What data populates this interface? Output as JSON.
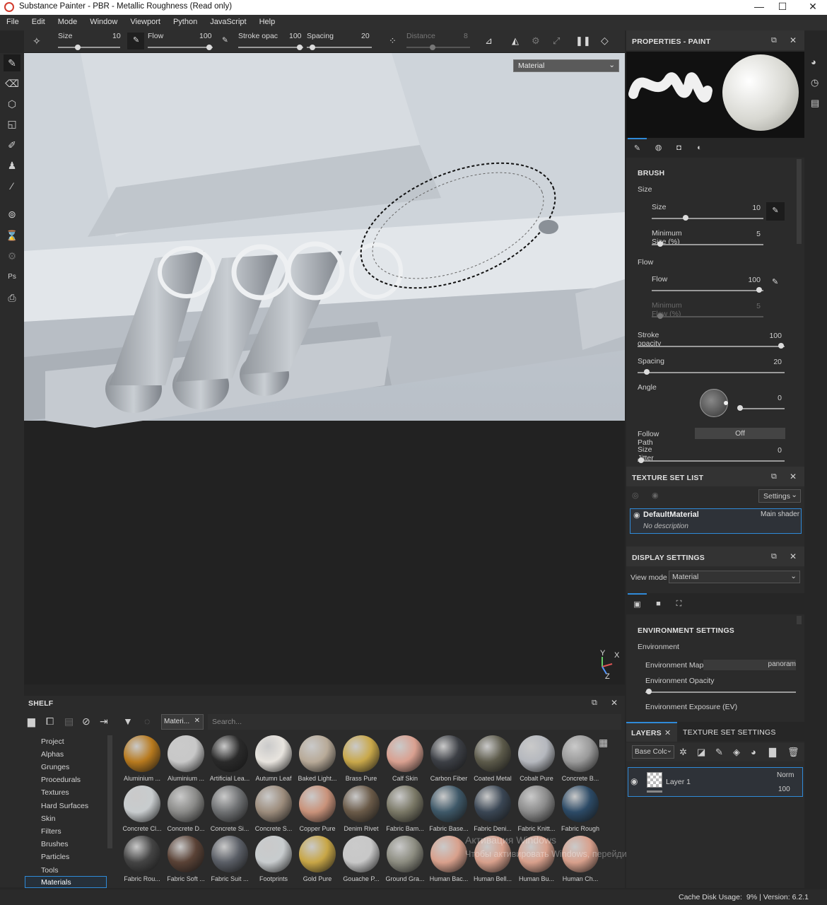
{
  "window": {
    "title": "Substance Painter - PBR - Metallic Roughness (Read only)"
  },
  "menu": [
    "File",
    "Edit",
    "Mode",
    "Window",
    "Viewport",
    "Python",
    "JavaScript",
    "Help"
  ],
  "toolbar": {
    "size_label": "Size",
    "size_value": "10",
    "flow_label": "Flow",
    "flow_value": "100",
    "stroke_label": "Stroke opac",
    "stroke_value": "100",
    "spacing_label": "Spacing",
    "spacing_value": "20",
    "distance_label": "Distance",
    "distance_value": "8"
  },
  "viewport": {
    "mode": "Material",
    "axis_y": "Y",
    "axis_x": "X",
    "axis_z": "Z"
  },
  "shelf": {
    "title": "SHELF",
    "filter_tag": "Materi...",
    "search_placeholder": "Search...",
    "categories": [
      "Project",
      "Alphas",
      "Grunges",
      "Procedurals",
      "Textures",
      "Hard Surfaces",
      "Skin",
      "Filters",
      "Brushes",
      "Particles",
      "Tools",
      "Materials"
    ],
    "materials": [
      {
        "label": "Aluminium ...",
        "color": "#b87a1e"
      },
      {
        "label": "Aluminium ...",
        "color": "#c8c8c8"
      },
      {
        "label": "Artificial Lea...",
        "color": "#2a2a2a"
      },
      {
        "label": "Autumn Leaf",
        "color": "#e8e4de"
      },
      {
        "label": "Baked Light...",
        "color": "#b8aa98"
      },
      {
        "label": "Brass Pure",
        "color": "#c9a84a"
      },
      {
        "label": "Calf Skin",
        "color": "#d9a090"
      },
      {
        "label": "Carbon Fiber",
        "color": "#3c3f45"
      },
      {
        "label": "Coated Metal",
        "color": "#5c5a4a"
      },
      {
        "label": "Cobalt Pure",
        "color": "#b5b8be"
      },
      {
        "label": "Concrete B...",
        "color": "#9a9a9a"
      },
      {
        "label": "Concrete Cl...",
        "color": "#c8ccce"
      },
      {
        "label": "Concrete D...",
        "color": "#8a8a88"
      },
      {
        "label": "Concrete Si...",
        "color": "#6e7072"
      },
      {
        "label": "Concrete S...",
        "color": "#9c8c7c"
      },
      {
        "label": "Copper Pure",
        "color": "#c9927a"
      },
      {
        "label": "Denim Rivet",
        "color": "#6a5a48"
      },
      {
        "label": "Fabric Bam...",
        "color": "#7a7866"
      },
      {
        "label": "Fabric Base...",
        "color": "#3e5868"
      },
      {
        "label": "Fabric Deni...",
        "color": "#3a4654"
      },
      {
        "label": "Fabric Knitt...",
        "color": "#8a8a8a"
      },
      {
        "label": "Fabric Rough",
        "color": "#2c4a66"
      },
      {
        "label": "Fabric Rou...",
        "color": "#444"
      },
      {
        "label": "Fabric Soft ...",
        "color": "#5a4236"
      },
      {
        "label": "Fabric Suit ...",
        "color": "#5a5e66"
      },
      {
        "label": "Footprints",
        "color": "#c8ccce"
      },
      {
        "label": "Gold Pure",
        "color": "#c8a646"
      },
      {
        "label": "Gouache P...",
        "color": "#c8c8c8"
      },
      {
        "label": "Ground Gra...",
        "color": "#8c8c80"
      },
      {
        "label": "Human Bac...",
        "color": "#d8a08c"
      },
      {
        "label": "Human Bell...",
        "color": "#d8a08c"
      },
      {
        "label": "Human Bu...",
        "color": "#d8a08c"
      },
      {
        "label": "Human Ch...",
        "color": "#d8a08c"
      }
    ]
  },
  "properties": {
    "title": "PROPERTIES - PAINT",
    "section": "BRUSH",
    "size_group": "Size",
    "size_label": "Size",
    "size_value": "10",
    "min_size_label": "Minimum Size (%)",
    "min_size_value": "5",
    "flow_group": "Flow",
    "flow_label": "Flow",
    "flow_value": "100",
    "min_flow_label": "Minimum Flow (%)",
    "min_flow_value": "5",
    "stroke_label": "Stroke opacity",
    "stroke_value": "100",
    "spacing_label": "Spacing",
    "spacing_value": "20",
    "angle_label": "Angle",
    "angle_value": "0",
    "follow_label": "Follow Path",
    "follow_value": "Off",
    "jitter_label": "Size Jitter",
    "jitter_value": "0"
  },
  "texture_set_list": {
    "title": "TEXTURE SET LIST",
    "settings_label": "Settings",
    "material_name": "DefaultMaterial",
    "shader": "Main shader",
    "description": "No description"
  },
  "display_settings": {
    "title": "DISPLAY SETTINGS",
    "view_mode_label": "View mode",
    "view_mode_value": "Material",
    "env_section": "ENVIRONMENT SETTINGS",
    "env_group": "Environment",
    "env_map_label": "Environment Map",
    "env_map_value": "panoram",
    "env_opacity_label": "Environment Opacity",
    "env_exposure_label": "Environment Exposure (EV)"
  },
  "layers": {
    "tab_layers": "LAYERS",
    "tab_tss": "TEXTURE SET SETTINGS",
    "channel": "Base Colc",
    "layer_name": "Layer 1",
    "blend": "Norm",
    "opacity": "100"
  },
  "watermark": {
    "line1": "Активация Windows",
    "line2": "Чтобы активировать Windows, перейдите в раздел \"Параметры\"."
  },
  "status": {
    "cache_label": "Cache Disk Usage:",
    "cache_value": "9% | Version: 6.2.1"
  }
}
